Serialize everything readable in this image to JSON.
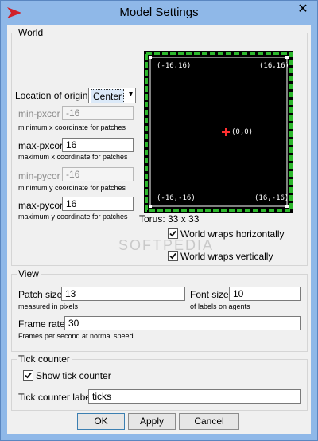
{
  "window": {
    "title": "Model Settings",
    "close_glyph": "✕",
    "app_icon": "netlogo-arrow-icon"
  },
  "world": {
    "label": "World",
    "origin_label": "Location of origin:",
    "origin_value": "Center",
    "min_pxcor": {
      "label": "min-pxcor",
      "value": "-16",
      "hint": "minimum x coordinate for patches"
    },
    "max_pxcor": {
      "label": "max-pxcor",
      "value": "16",
      "hint": "maximum x coordinate for patches"
    },
    "min_pycor": {
      "label": "min-pycor",
      "value": "-16",
      "hint": "minimum y coordinate for patches"
    },
    "max_pycor": {
      "label": "max-pycor",
      "value": "16",
      "hint": "maximum y coordinate for patches"
    },
    "preview": {
      "top_left": "(-16,16)",
      "top_right": "(16,16)",
      "center": "(0,0)",
      "bottom_left": "(-16,-16)",
      "bottom_right": "(16,-16)"
    },
    "torus_label": "Torus: 33 x 33",
    "wrap_h": {
      "label": "World wraps horizontally",
      "checked": true
    },
    "wrap_v": {
      "label": "World wraps vertically",
      "checked": true
    }
  },
  "view": {
    "label": "View",
    "patch_size": {
      "label": "Patch size",
      "value": "13",
      "hint": "measured in pixels"
    },
    "font_size": {
      "label": "Font size",
      "value": "10",
      "hint": "of labels on agents"
    },
    "frame_rate": {
      "label": "Frame rate",
      "value": "30",
      "hint": "Frames per second at normal speed"
    }
  },
  "tick": {
    "label": "Tick counter",
    "show": {
      "label": "Show tick counter",
      "checked": true
    },
    "counter_label": {
      "label": "Tick counter label",
      "value": "ticks"
    }
  },
  "buttons": {
    "ok": "OK",
    "apply": "Apply",
    "cancel": "Cancel"
  },
  "watermark": "SOFTPEDIA",
  "colors": {
    "accent": "#8fb8e8",
    "preview_border": "#2db82d",
    "origin_marker": "#ff3030"
  }
}
